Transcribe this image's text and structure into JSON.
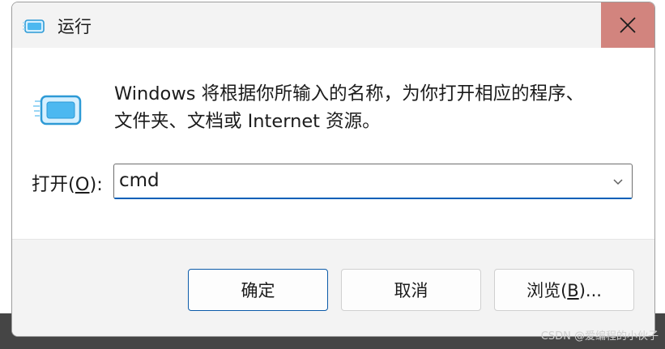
{
  "window": {
    "title": "运行",
    "close_icon": "close-icon",
    "app_icon": "run-dialog-icon"
  },
  "description": {
    "line1": "Windows 将根据你所输入的名称，为你打开相应的程序、",
    "line2": "文件夹、文档或 Internet 资源。"
  },
  "open_field": {
    "label_prefix": "打开(",
    "label_accel": "O",
    "label_suffix": "):",
    "value": "cmd",
    "dropdown_icon": "chevron-down-icon"
  },
  "buttons": {
    "ok_label": "确定",
    "cancel_label": "取消",
    "browse_prefix": "浏览(",
    "browse_accel": "B",
    "browse_suffix": ")..."
  },
  "watermark": {
    "text": "CSDN @爱编程的小伙子"
  },
  "colors": {
    "accent": "#005fb8",
    "close_bg": "#d2847e",
    "titlebar_bg": "#f3f3f3",
    "icon_blue": "#4cb8f0"
  }
}
